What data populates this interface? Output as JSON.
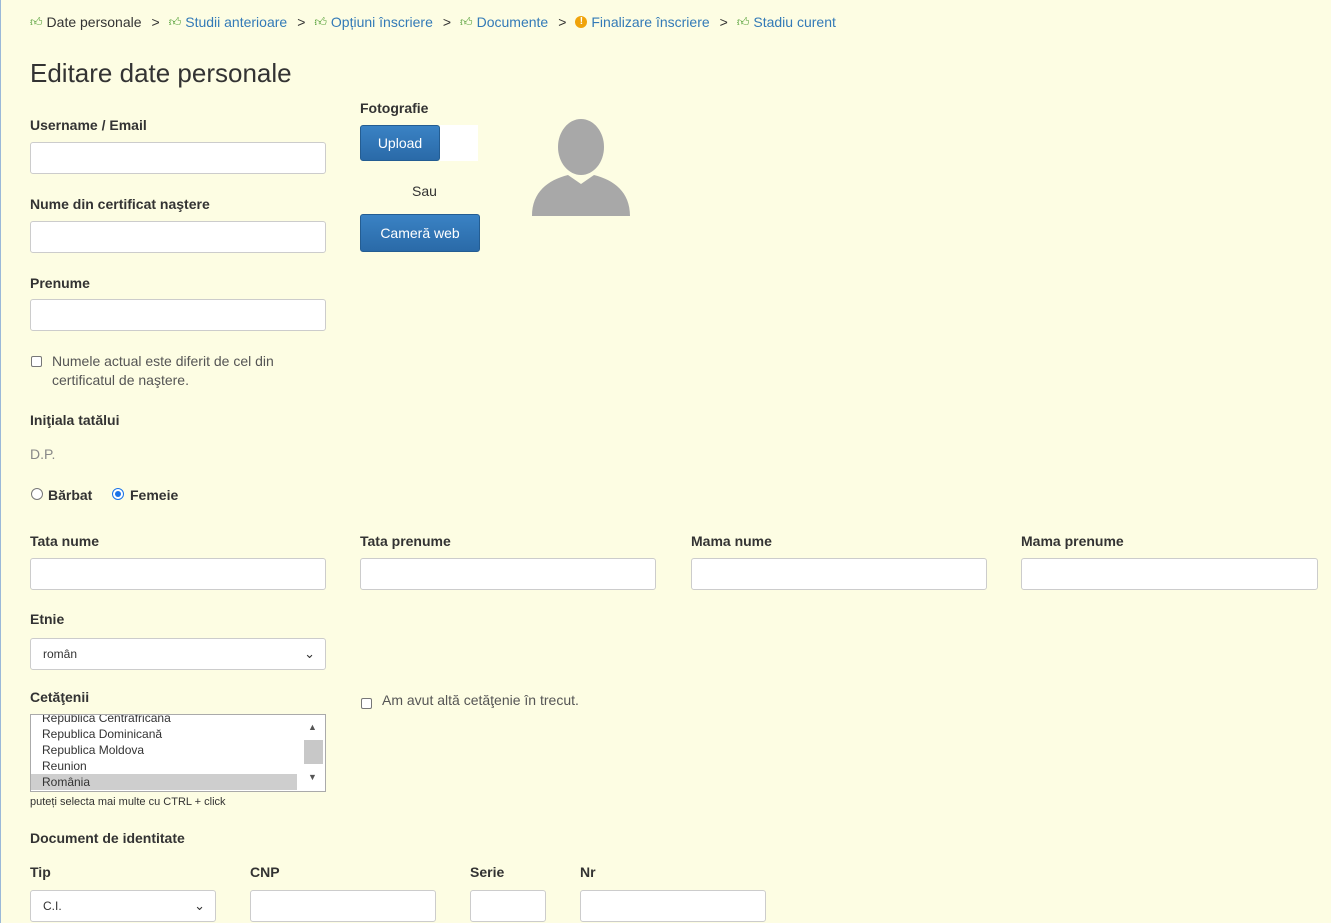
{
  "breadcrumb": {
    "items": [
      {
        "label": "Date personale",
        "status": "done",
        "link": false
      },
      {
        "label": "Studii anterioare",
        "status": "done",
        "link": true
      },
      {
        "label": "Opțiuni înscriere",
        "status": "done",
        "link": true
      },
      {
        "label": "Documente",
        "status": "done",
        "link": true
      },
      {
        "label": "Finalizare înscriere",
        "status": "warning",
        "link": true
      },
      {
        "label": "Stadiu curent",
        "status": "done",
        "link": true
      }
    ],
    "separator": ">"
  },
  "page_title": "Editare date personale",
  "form": {
    "username_label": "Username / Email",
    "username_value": "",
    "birth_name_label": "Nume din certificat naştere",
    "birth_name_value": "",
    "first_name_label": "Prenume",
    "first_name_value": "",
    "name_changed_label_line1": "Numele actual este diferit de cel din",
    "name_changed_label_line2": "certificatul de naştere.",
    "name_changed_checked": false,
    "father_initial_label": "Iniţiala tatălui",
    "father_initial_value": "D.P.",
    "gender_male_label": "Bărbat",
    "gender_female_label": "Femeie",
    "gender_selected": "Femeie",
    "father_last_label": "Tata nume",
    "father_first_label": "Tata prenume",
    "mother_last_label": "Mama nume",
    "mother_first_label": "Mama prenume",
    "ethnicity_label": "Etnie",
    "ethnicity_value": "român",
    "citizenship_label": "Cetăţenii",
    "citizenship_options": [
      "Republica Centrafricană",
      "Republica Dominicană",
      "Republica Moldova",
      "Reunion",
      "România"
    ],
    "citizenship_selected": "România",
    "citizenship_hint": "puteți selecta mai multe cu CTRL + click",
    "other_citizenship_label": "Am avut altă cetăţenie în trecut.",
    "other_citizenship_checked": false,
    "id_doc_heading": "Document de identitate",
    "id_type_label": "Tip",
    "id_type_value": "C.I.",
    "cnp_label": "CNP",
    "series_label": "Serie",
    "number_label": "Nr"
  },
  "photo": {
    "label": "Fotografie",
    "upload_button": "Upload",
    "or_text": "Sau",
    "webcam_button": "Cameră web",
    "avatar_icon": "user-silhouette-icon"
  },
  "colors": {
    "background": "#fdfde3",
    "primary_button": "#2e6da4",
    "link": "#337ab7",
    "done_icon": "#4a9a2e",
    "warning_icon": "#f0a30a"
  }
}
